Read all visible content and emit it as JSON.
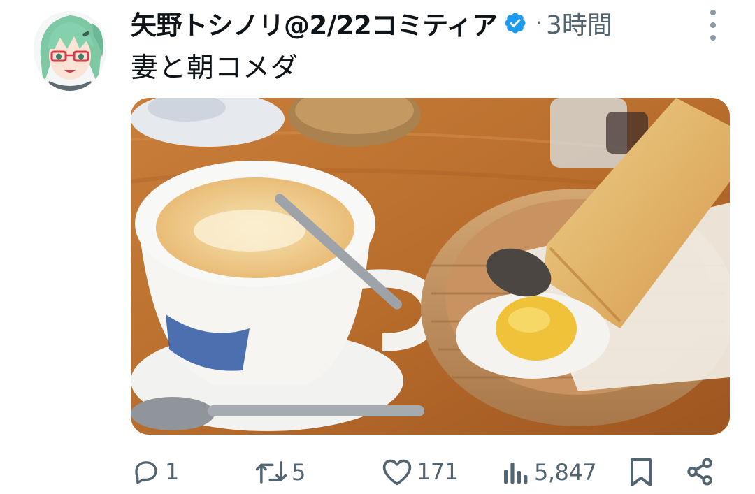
{
  "author": {
    "display_name": "矢野トシノリ@2/22コミティア",
    "avatar_icon": "anime-avatar-icon",
    "verified_icon": "verified-badge-icon",
    "verified_color": "#1d9bf0"
  },
  "tweet": {
    "separator": "·",
    "timestamp": "3時間",
    "text": "妻と朝コメダ",
    "media_icon": "photo-coffee-toast-breakfast"
  },
  "actions": {
    "reply_count": "1",
    "retweet_count": "5",
    "like_count": "171",
    "views_count": "5,847"
  },
  "colors": {
    "text_primary": "#0f1419",
    "text_secondary": "#536471"
  }
}
